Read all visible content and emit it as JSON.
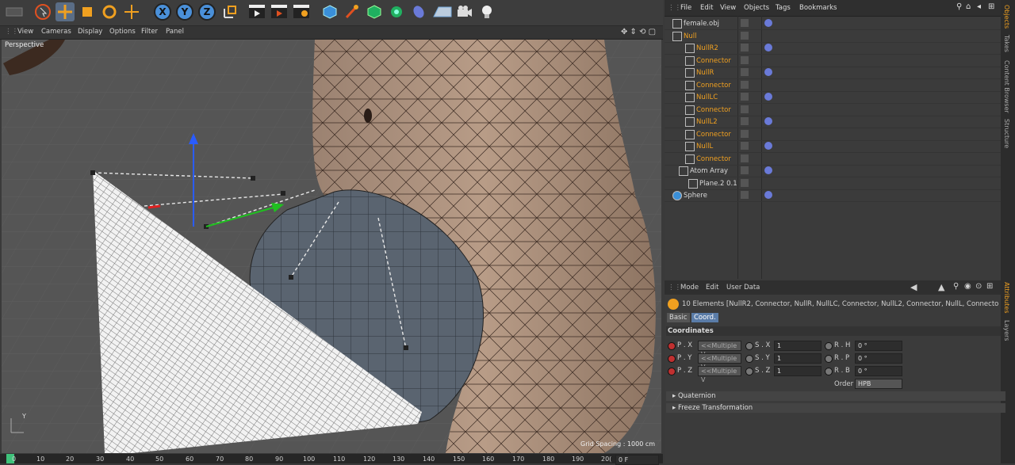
{
  "viewport": {
    "menu": [
      "View",
      "Cameras",
      "Display",
      "Options",
      "Filter",
      "Panel"
    ],
    "camera_label": "Perspective",
    "grid_spacing": "Grid Spacing : 1000 cm"
  },
  "toolbar": {
    "axis_x": "X",
    "axis_y": "Y",
    "axis_z": "Z"
  },
  "timeline": {
    "ticks": [
      "0",
      "10",
      "20",
      "30",
      "40",
      "50",
      "60",
      "70",
      "80",
      "90",
      "100",
      "110",
      "120",
      "130",
      "140",
      "150",
      "160",
      "170",
      "180",
      "190",
      "20("
    ],
    "field": "0 F"
  },
  "objects": {
    "menu": [
      "File",
      "Edit",
      "View",
      "Objects",
      "Tags",
      "Bookmarks"
    ],
    "rows": [
      {
        "name": "female.obj",
        "color": "#d8d8d8"
      },
      {
        "name": "Null",
        "color": "#f0a020"
      },
      {
        "name": "NullR2",
        "color": "#f0a020"
      },
      {
        "name": "Connector",
        "color": "#f0a020"
      },
      {
        "name": "NullR",
        "color": "#f0a020"
      },
      {
        "name": "Connector",
        "color": "#f0a020"
      },
      {
        "name": "NullLC",
        "color": "#f0a020"
      },
      {
        "name": "Connector",
        "color": "#f0a020"
      },
      {
        "name": "NullL2",
        "color": "#f0a020"
      },
      {
        "name": "Connector",
        "color": "#f0a020"
      },
      {
        "name": "NullL",
        "color": "#f0a020"
      },
      {
        "name": "Connector",
        "color": "#f0a020"
      },
      {
        "name": "Atom Array",
        "color": "#d8d8d8"
      },
      {
        "name": "Plane.2 0.1",
        "color": "#d8d8d8"
      },
      {
        "name": "Sphere",
        "color": "#d8d8d8"
      }
    ]
  },
  "sidetabs": [
    "Objects",
    "Takes",
    "Content Browser",
    "Structure",
    "Attributes",
    "Layers"
  ],
  "attributes": {
    "menu": [
      "Mode",
      "Edit",
      "User Data"
    ],
    "header": "10 Elements [NullR2, Connector, NullR, NullLC, Connector, NullL2, Connector, NullL, Connecto",
    "tabs": [
      "Basic",
      "Coord."
    ],
    "section": "Coordinates",
    "pos": {
      "px": "P . X",
      "py": "P . Y",
      "pz": "P . Z",
      "val": "<<Multiple V"
    },
    "scale": {
      "sx": "S . X",
      "sy": "S . Y",
      "sz": "S . Z",
      "val": "1"
    },
    "rot": {
      "rh": "R . H",
      "rp": "R . P",
      "rb": "R . B",
      "val": "0 °"
    },
    "order_label": "Order",
    "order_value": "HPB",
    "quaternion": "Quaternion",
    "freeze": "Freeze Transformation"
  }
}
